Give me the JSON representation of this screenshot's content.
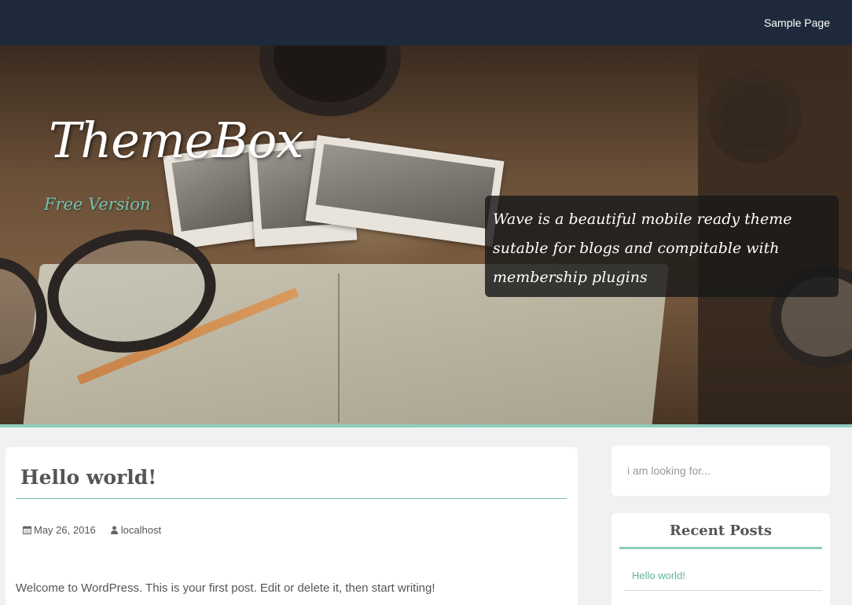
{
  "nav": {
    "sample_page": "Sample Page"
  },
  "header": {
    "site_title": "ThemeBox",
    "site_subtitle": "Free Version",
    "tagline": "Wave is a beautiful mobile ready theme sutable for blogs and compitable with membership plugins"
  },
  "post": {
    "title": "Hello world!",
    "date": "May 26, 2016",
    "author": "localhost",
    "excerpt": "Welcome to WordPress. This is your first post. Edit or delete it, then start writing!"
  },
  "sidebar": {
    "search": {
      "placeholder": "i am looking for..."
    },
    "recent_posts": {
      "title": "Recent Posts",
      "items": [
        "Hello world!"
      ]
    }
  },
  "colors": {
    "topbar": "#1e2a3c",
    "accent": "#74c1b1",
    "background": "#f1f1f1"
  },
  "icons": [
    "calendar-icon",
    "user-icon"
  ]
}
